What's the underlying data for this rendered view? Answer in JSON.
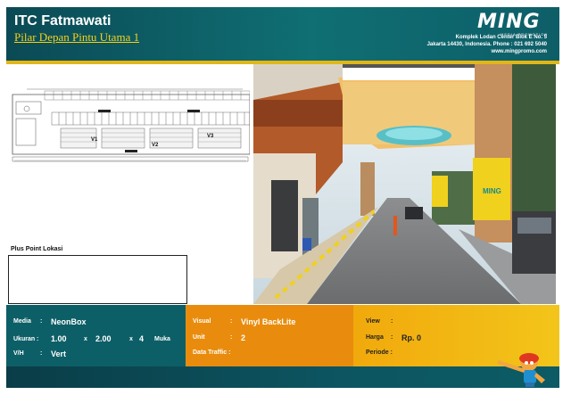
{
  "header": {
    "title": "ITC Fatmawati",
    "subtitle": "Pilar Depan Pintu Utama 1"
  },
  "brand": {
    "logo_text": "MING",
    "logo_tagline": "MEDIA PROMOTION",
    "address_line1": "Komplek Lodan Center Blok E No. 5",
    "address_line2": "Jakarta 14430, Indonesia. Phone : 021 692 5040",
    "website": "www.mingpromo.com"
  },
  "map": {
    "labels": [
      "V1",
      "V2",
      "V3"
    ]
  },
  "plus_point": {
    "label": "Plus Point Lokasi",
    "content": ""
  },
  "photo": {
    "sign_text": "MING"
  },
  "details": {
    "media_label": "Media",
    "media_value": "NeonBox",
    "ukuran_label": "Ukuran :",
    "ukuran_w": "1.00",
    "ukuran_x1": "x",
    "ukuran_h": "2.00",
    "ukuran_x2": "x",
    "ukuran_n": "4",
    "ukuran_muka": "Muka",
    "vh_label": "V/H",
    "vh_value": "Vert",
    "visual_label": "Visual",
    "visual_value": "Vinyl BackLite",
    "unit_label": "Unit",
    "unit_value": "2",
    "traffic_label": "Data Traffic :",
    "view_label": "View",
    "harga_label": "Harga",
    "harga_value": "Rp. 0",
    "periode_label": "Periode :"
  },
  "colors": {
    "header_teal": "#0f6f73",
    "stripe_yellow": "#e3b617",
    "info_teal": "#0d5f67",
    "info_orange": "#e98c0d",
    "info_yellow": "#f3c51a"
  }
}
